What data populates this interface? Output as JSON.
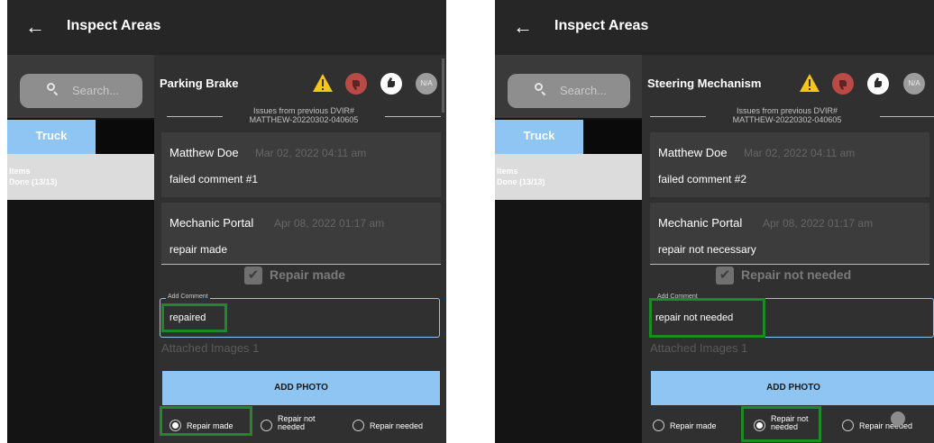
{
  "panels": [
    {
      "title": "Inspect Areas",
      "search_placeholder": "Search...",
      "tab_label": "Truck",
      "items_label": "Items",
      "items_status": "Done (13/13)",
      "item_name": "Parking Brake",
      "na_label": "N/A",
      "issues_line1": "Issues from previous DVIR#",
      "issues_line2": "MATTHEW-20220302-040605",
      "comment1": {
        "author": "Matthew Doe",
        "date": "Mar 02, 2022 04:11 am",
        "text": "failed comment #1"
      },
      "comment2": {
        "author": "Mechanic Portal",
        "date": "Apr 08, 2022 01:17 am",
        "text": "repair made"
      },
      "repair_check_label": "Repair made",
      "add_comment_label": "Add Comment",
      "add_comment_value": "repaired",
      "attached_images": "Attached Images 1",
      "add_photo": "ADD PHOTO",
      "radio_options": [
        "Repair made",
        "Repair not needed",
        "Repair needed"
      ],
      "radio_selected": "Repair made"
    },
    {
      "title": "Inspect Areas",
      "search_placeholder": "Search...",
      "tab_label": "Truck",
      "items_label": "Items",
      "items_status": "Done (13/13)",
      "item_name": "Steering Mechanism",
      "na_label": "N/A",
      "issues_line1": "Issues from previous DVIR#",
      "issues_line2": "MATTHEW-20220302-040605",
      "comment1": {
        "author": "Matthew Doe",
        "date": "Mar 02, 2022 04:11 am",
        "text": "failed comment #2"
      },
      "comment2": {
        "author": "Mechanic Portal",
        "date": "Apr 08, 2022 01:17 am",
        "text": "repair not necessary"
      },
      "repair_check_label": "Repair not needed",
      "add_comment_label": "Add Comment",
      "add_comment_value": "repair not needed",
      "attached_images": "Attached Images 1",
      "add_photo": "ADD PHOTO",
      "radio_options": [
        "Repair made",
        "Repair not needed",
        "Repair needed"
      ],
      "radio_selected": "Repair not needed"
    }
  ],
  "colors": {
    "accent": "#8ec5f2",
    "fail": "#b94a45",
    "warning": "#f5c518",
    "highlight": "#1e8a26"
  }
}
